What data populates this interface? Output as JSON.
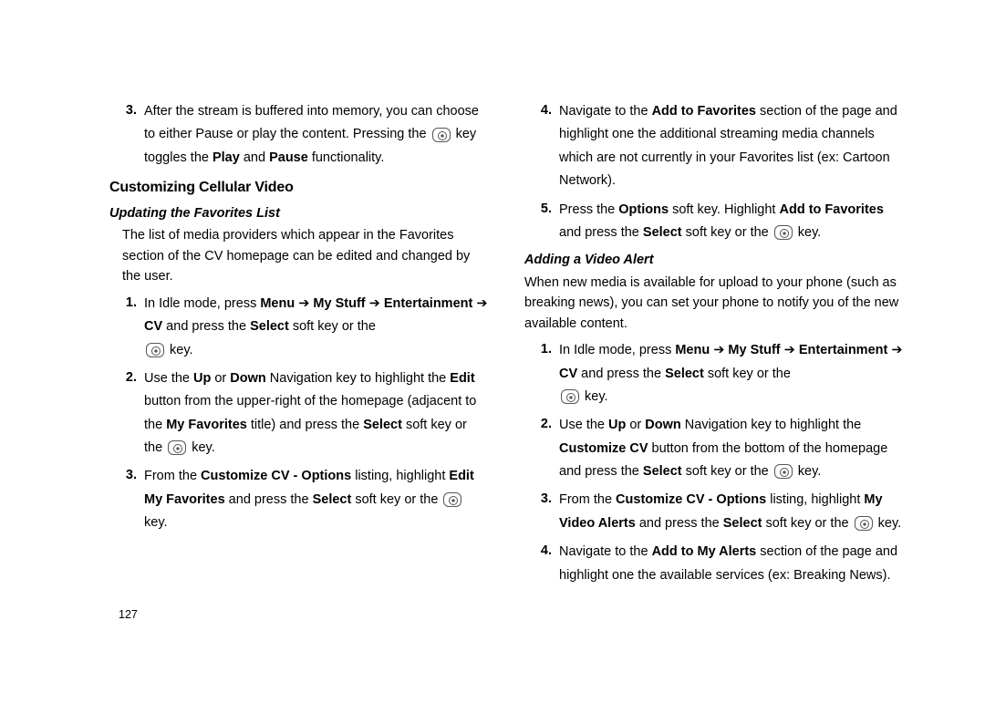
{
  "page_number": "127",
  "left": {
    "top_item": {
      "num": "3.",
      "parts": [
        "After the stream is buffered into memory, you can choose to either Pause or play the content. Pressing the ",
        " key toggles the ",
        "Play",
        " and ",
        "Pause",
        " functionality."
      ]
    },
    "heading": "Customizing Cellular Video",
    "sub1": "Updating the Favorites List",
    "intro1": "The list of media providers which appear in the Favorites section of the CV homepage can be edited and changed by the user.",
    "steps1": [
      {
        "num": "1.",
        "parts": [
          "In Idle mode, press ",
          "Menu",
          " ➔ ",
          "My Stuff",
          " ➔ ",
          "Entertainment",
          " ➔ ",
          "CV",
          " and press the ",
          "Select",
          " soft key or the "
        ],
        "tail": " key."
      },
      {
        "num": "2.",
        "parts": [
          "Use the ",
          "Up",
          " or ",
          "Down",
          " Navigation key to highlight the ",
          "Edit",
          " button from the upper-right of the homepage (adjacent to the ",
          "My Favorites",
          " title) and press the ",
          "Select",
          " soft key or the "
        ],
        "tail": " key."
      },
      {
        "num": "3.",
        "parts": [
          "From the ",
          "Customize CV - Options",
          " listing, highlight ",
          "Edit My Favorites",
          " and press the ",
          "Select",
          " soft key or the "
        ],
        "tail": " key."
      }
    ]
  },
  "right": {
    "steps_top": [
      {
        "num": "4.",
        "parts": [
          "Navigate to the ",
          "Add to Favorites",
          " section of the page and highlight one the additional streaming media channels which are not currently in your Favorites list (ex: Cartoon Network)."
        ]
      },
      {
        "num": "5.",
        "parts": [
          "Press the ",
          "Options",
          " soft key. Highlight ",
          "Add to Favorites",
          " and press the ",
          "Select",
          " soft key or the "
        ],
        "tail": " key."
      }
    ],
    "sub2": "Adding a Video Alert",
    "intro2": "When new media is available for upload to your phone (such as breaking news), you can set your phone to notify you of the new available content.",
    "steps2": [
      {
        "num": "1.",
        "parts": [
          "In Idle mode, press ",
          "Menu",
          " ➔ ",
          "My Stuff",
          " ➔ ",
          "Entertainment",
          " ➔ ",
          "CV",
          " and press the ",
          "Select",
          " soft key or the "
        ],
        "tail": " key."
      },
      {
        "num": "2.",
        "parts": [
          "Use the ",
          "Up",
          " or ",
          "Down",
          " Navigation key to highlight the ",
          "Customize CV",
          " button from the bottom of the homepage and press the ",
          "Select",
          " soft key or the "
        ],
        "tail": " key."
      },
      {
        "num": "3.",
        "parts": [
          "From the ",
          "Customize CV - Options",
          " listing, highlight ",
          "My Video Alerts",
          " and press the ",
          "Select",
          " soft key or the "
        ],
        "tail": " key."
      },
      {
        "num": "4.",
        "parts": [
          "Navigate to the ",
          "Add to My Alerts",
          " section of the page and highlight one the available services (ex: Breaking News)."
        ]
      }
    ]
  }
}
